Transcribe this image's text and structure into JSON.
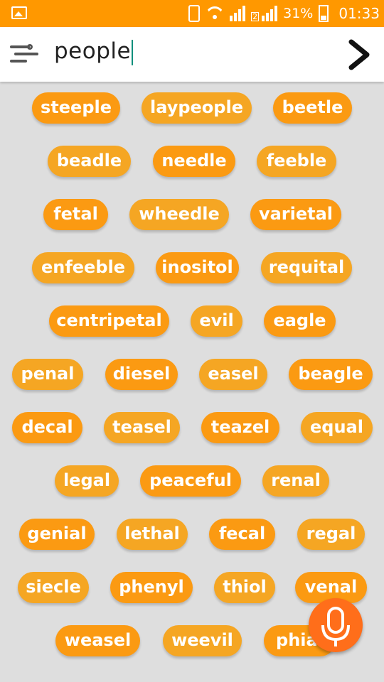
{
  "status": {
    "battery_text": "31%",
    "time": "01:33",
    "sim2_label": "2"
  },
  "search": {
    "query": "people"
  },
  "colors": {
    "accent": "#ff9800",
    "chip": "#f5a623",
    "chip_dark": "#fb9a12",
    "fab": "#ff6e1a",
    "background": "#dedede"
  },
  "icons": {
    "menu": "wind-lines-icon",
    "submit": "chevron-right-icon",
    "voice": "microphone-icon"
  },
  "words": [
    [
      "steeple",
      "laypeople",
      "beetle"
    ],
    [
      "beadle",
      "needle",
      "feeble"
    ],
    [
      "fetal",
      "wheedle",
      "varietal"
    ],
    [
      "enfeeble",
      "inositol",
      "requital"
    ],
    [
      "centripetal",
      "evil",
      "eagle"
    ],
    [
      "penal",
      "diesel",
      "easel",
      "beagle"
    ],
    [
      "decal",
      "teasel",
      "teazel",
      "equal"
    ],
    [
      "legal",
      "peaceful",
      "renal"
    ],
    [
      "genial",
      "lethal",
      "fecal",
      "regal"
    ],
    [
      "siecle",
      "phenyl",
      "thiol",
      "venal"
    ],
    [
      "weasel",
      "weevil",
      "phial"
    ]
  ]
}
